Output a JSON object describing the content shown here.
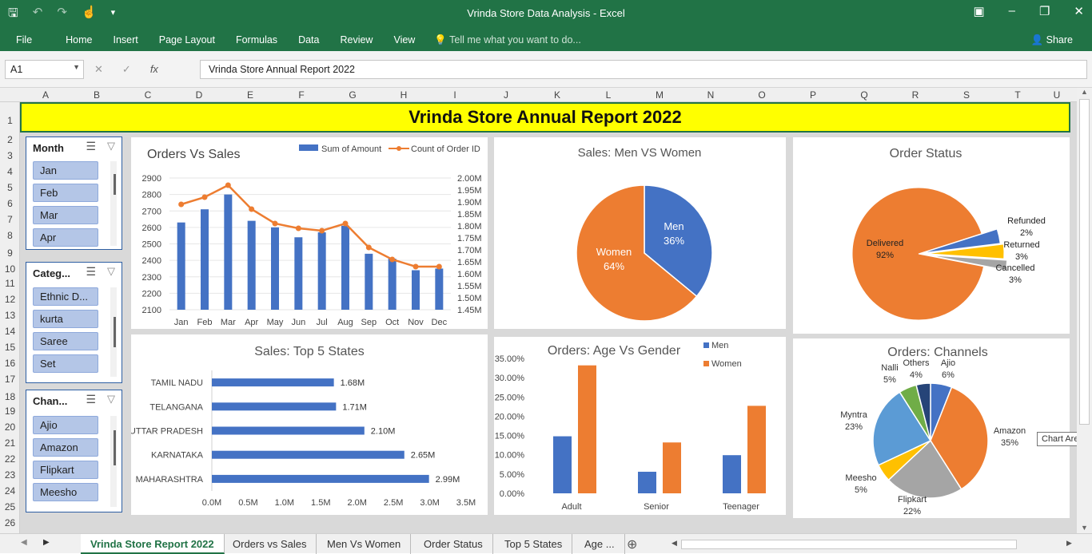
{
  "window": {
    "title": "Vrinda Store Data Analysis - Excel"
  },
  "ribbon": {
    "file": "File",
    "tabs": [
      "Home",
      "Insert",
      "Page Layout",
      "Formulas",
      "Data",
      "Review",
      "View"
    ],
    "tell": "Tell me what you want to do...",
    "share": "Share"
  },
  "formula": {
    "namebox": "A1",
    "content": "Vrinda Store Annual Report 2022"
  },
  "columns": [
    "A",
    "B",
    "C",
    "D",
    "E",
    "F",
    "G",
    "H",
    "I",
    "J",
    "K",
    "L",
    "M",
    "N",
    "O",
    "P",
    "Q",
    "R",
    "S",
    "T",
    "U"
  ],
  "rows": [
    "1",
    "2",
    "3",
    "4",
    "5",
    "6",
    "7",
    "8",
    "9",
    "10",
    "11",
    "12",
    "13",
    "14",
    "15",
    "16",
    "17",
    "18",
    "19",
    "20",
    "21",
    "22",
    "23",
    "24",
    "25",
    "26"
  ],
  "banner": "Vrinda Store Annual Report 2022",
  "slicers": [
    {
      "header": "Month",
      "items": [
        "Jan",
        "Feb",
        "Mar",
        "Apr"
      ]
    },
    {
      "header": "Categ...",
      "items": [
        "Ethnic D...",
        "kurta",
        "Saree",
        "Set"
      ]
    },
    {
      "header": "Chan...",
      "items": [
        "Ajio",
        "Amazon",
        "Flipkart",
        "Meesho"
      ]
    }
  ],
  "sheet_tabs": [
    "Vrinda Store Report 2022",
    "Orders vs Sales",
    "Men Vs Women",
    "Order Status",
    "Top 5 States",
    "Age ..."
  ],
  "tooltip": "Chart Area",
  "colors": {
    "excel_green": "#217346",
    "blue": "#4472c4",
    "orange": "#ed7d31",
    "gray": "#a5a5a5",
    "yellow": "#ffc000"
  },
  "chart_data": [
    {
      "type": "bar",
      "title": "Orders Vs Sales",
      "categories": [
        "Jan",
        "Feb",
        "Mar",
        "Apr",
        "May",
        "Jun",
        "Jul",
        "Aug",
        "Sep",
        "Oct",
        "Nov",
        "Dec"
      ],
      "series": [
        {
          "name": "Sum of Amount",
          "axis": "left",
          "values": [
            2630,
            2710,
            2800,
            2640,
            2600,
            2540,
            2570,
            2610,
            2440,
            2410,
            2340,
            2350
          ]
        },
        {
          "name": "Count of Order ID",
          "axis": "right",
          "type": "line",
          "values": [
            1.89,
            1.92,
            1.97,
            1.87,
            1.81,
            1.79,
            1.78,
            1.81,
            1.71,
            1.66,
            1.63,
            1.63
          ]
        }
      ],
      "ylim": [
        2100,
        2900
      ],
      "yticks": [
        "2900",
        "2800",
        "2700",
        "2600",
        "2500",
        "2400",
        "2300",
        "2200",
        "2100"
      ],
      "y2lim": [
        1.45,
        2.0
      ],
      "y2ticks": [
        "2.00M",
        "1.95M",
        "1.90M",
        "1.85M",
        "1.80M",
        "1.75M",
        "1.70M",
        "1.65M",
        "1.60M",
        "1.55M",
        "1.50M",
        "1.45M"
      ],
      "legend": "top-right"
    },
    {
      "type": "pie",
      "title": "Sales: Men VS Women",
      "slices": [
        {
          "label": "Men",
          "value": 36,
          "text": "36%",
          "color": "#4472c4"
        },
        {
          "label": "Women",
          "value": 64,
          "text": "64%",
          "color": "#ed7d31"
        }
      ]
    },
    {
      "type": "pie",
      "title": "Order Status",
      "slices": [
        {
          "label": "Delivered",
          "value": 92,
          "text": "92%",
          "color": "#ed7d31"
        },
        {
          "label": "Refunded",
          "value": 2,
          "text": "2%",
          "color": "#a5a5a5"
        },
        {
          "label": "Returned",
          "value": 3,
          "text": "3%",
          "color": "#ffc000"
        },
        {
          "label": "Cancelled",
          "value": 3,
          "text": "3%",
          "color": "#4472c4"
        }
      ]
    },
    {
      "type": "bar",
      "orientation": "horizontal",
      "title": "Sales: Top 5 States",
      "categories": [
        "TAMIL NADU",
        "TELANGANA",
        "UTTAR PRADESH",
        "KARNATAKA",
        "MAHARASHTRA"
      ],
      "values": [
        1.68,
        1.71,
        2.1,
        2.65,
        2.99
      ],
      "value_labels": [
        "1.68M",
        "1.71M",
        "2.10M",
        "2.65M",
        "2.99M"
      ],
      "xlim": [
        0,
        3.5
      ],
      "xticks": [
        "0.0M",
        "0.5M",
        "1.0M",
        "1.5M",
        "2.0M",
        "2.5M",
        "3.0M",
        "3.5M"
      ]
    },
    {
      "type": "bar",
      "title": "Orders: Age Vs Gender",
      "categories": [
        "Adult",
        "Senior",
        "Teenager"
      ],
      "series": [
        {
          "name": "Men",
          "values": [
            14.8,
            5.6,
            9.9
          ]
        },
        {
          "name": "Women",
          "values": [
            33.2,
            13.2,
            22.7
          ]
        }
      ],
      "ylim": [
        0,
        35
      ],
      "yticks": [
        "35.00%",
        "30.00%",
        "25.00%",
        "20.00%",
        "15.00%",
        "10.00%",
        "5.00%",
        "0.00%"
      ],
      "legend": "top-right"
    },
    {
      "type": "pie",
      "title": "Orders: Channels",
      "slices": [
        {
          "label": "Ajio",
          "value": 6,
          "text": "6%",
          "color": "#4472c4"
        },
        {
          "label": "Amazon",
          "value": 35,
          "text": "35%",
          "color": "#ed7d31"
        },
        {
          "label": "Flipkart",
          "value": 22,
          "text": "22%",
          "color": "#a5a5a5"
        },
        {
          "label": "Meesho",
          "value": 5,
          "text": "5%",
          "color": "#ffc000"
        },
        {
          "label": "Myntra",
          "value": 23,
          "text": "23%",
          "color": "#5b9bd5"
        },
        {
          "label": "Nalli",
          "value": 5,
          "text": "5%",
          "color": "#70ad47"
        },
        {
          "label": "Others",
          "value": 4,
          "text": "4%",
          "color": "#264478"
        }
      ]
    }
  ]
}
